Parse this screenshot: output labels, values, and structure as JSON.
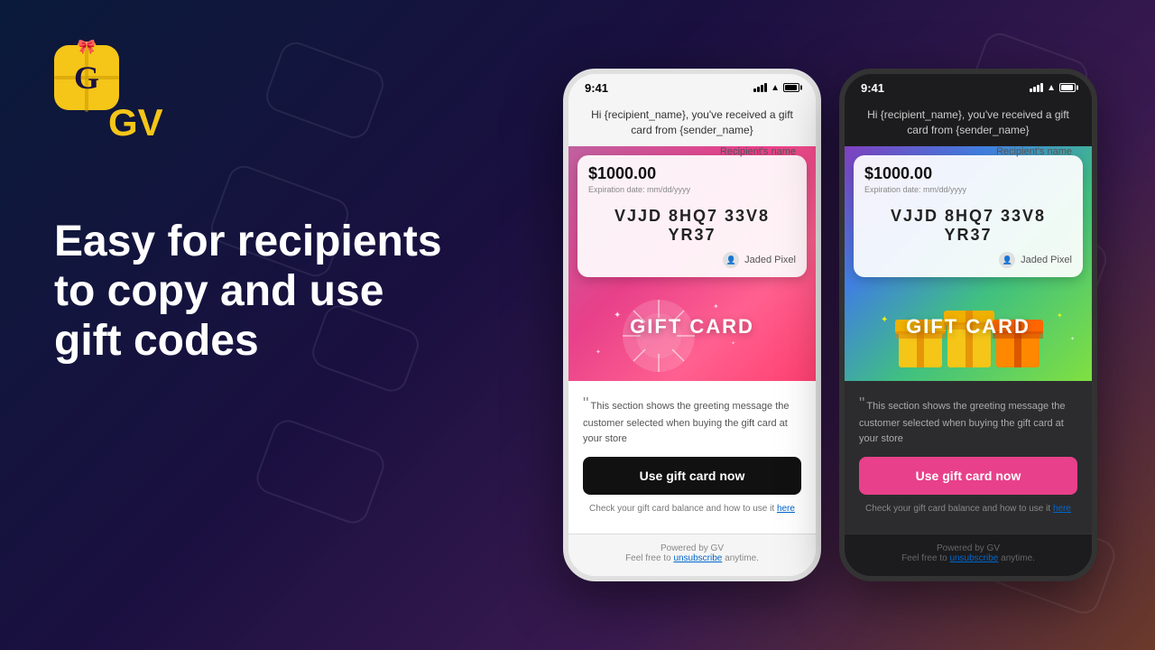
{
  "app": {
    "logo_letter": "G",
    "logo_text": "GV",
    "background_description": "dark gradient blue to purple to brown"
  },
  "tagline": {
    "line1": "Easy for recipients",
    "line2": "to copy and use",
    "line3": "gift codes"
  },
  "phone_light": {
    "status_time": "9:41",
    "email_header": "Hi {recipient_name}, you've received a gift card from {sender_name}",
    "card_amount": "$1000.00",
    "card_recipient": "Recipient's name",
    "card_expiry": "Expiration date: mm/dd/yyyy",
    "card_code": "VJJD 8HQ7 33V8 YR37",
    "card_user": "Jaded Pixel",
    "gift_card_label": "GIFT CARD",
    "greeting_message": "This section shows the greeting message the customer selected when buying the gift card at your store",
    "use_button": "Use gift card now",
    "balance_text": "Check your gift card balance and how to use it",
    "balance_link": "here",
    "footer_powered": "Powered by GV",
    "footer_unsub_text": "Feel free to",
    "footer_unsub_link": "unsubscribe",
    "footer_unsub_after": "anytime."
  },
  "phone_dark": {
    "status_time": "9:41",
    "email_header": "Hi {recipient_name}, you've received a gift card from {sender_name}",
    "card_amount": "$1000.00",
    "card_recipient": "Recipient's name",
    "card_expiry": "Expiration date: mm/dd/yyyy",
    "card_code": "VJJD 8HQ7 33V8 YR37",
    "card_user": "Jaded Pixel",
    "gift_card_label": "GIFT CARD",
    "greeting_message": "This section shows the greeting message the customer selected when buying the gift card at your store",
    "use_button": "Use gift card now",
    "balance_text": "Check your gift card balance and how to use it",
    "balance_link": "here",
    "footer_powered": "Powered by GV",
    "footer_unsub_text": "Feel free to",
    "footer_unsub_link": "unsubscribe",
    "footer_unsub_after": "anytime."
  },
  "colors": {
    "logo_yellow": "#f5c518",
    "brand_pink": "#e8408a",
    "brand_dark": "#111111",
    "text_white": "#ffffff"
  }
}
